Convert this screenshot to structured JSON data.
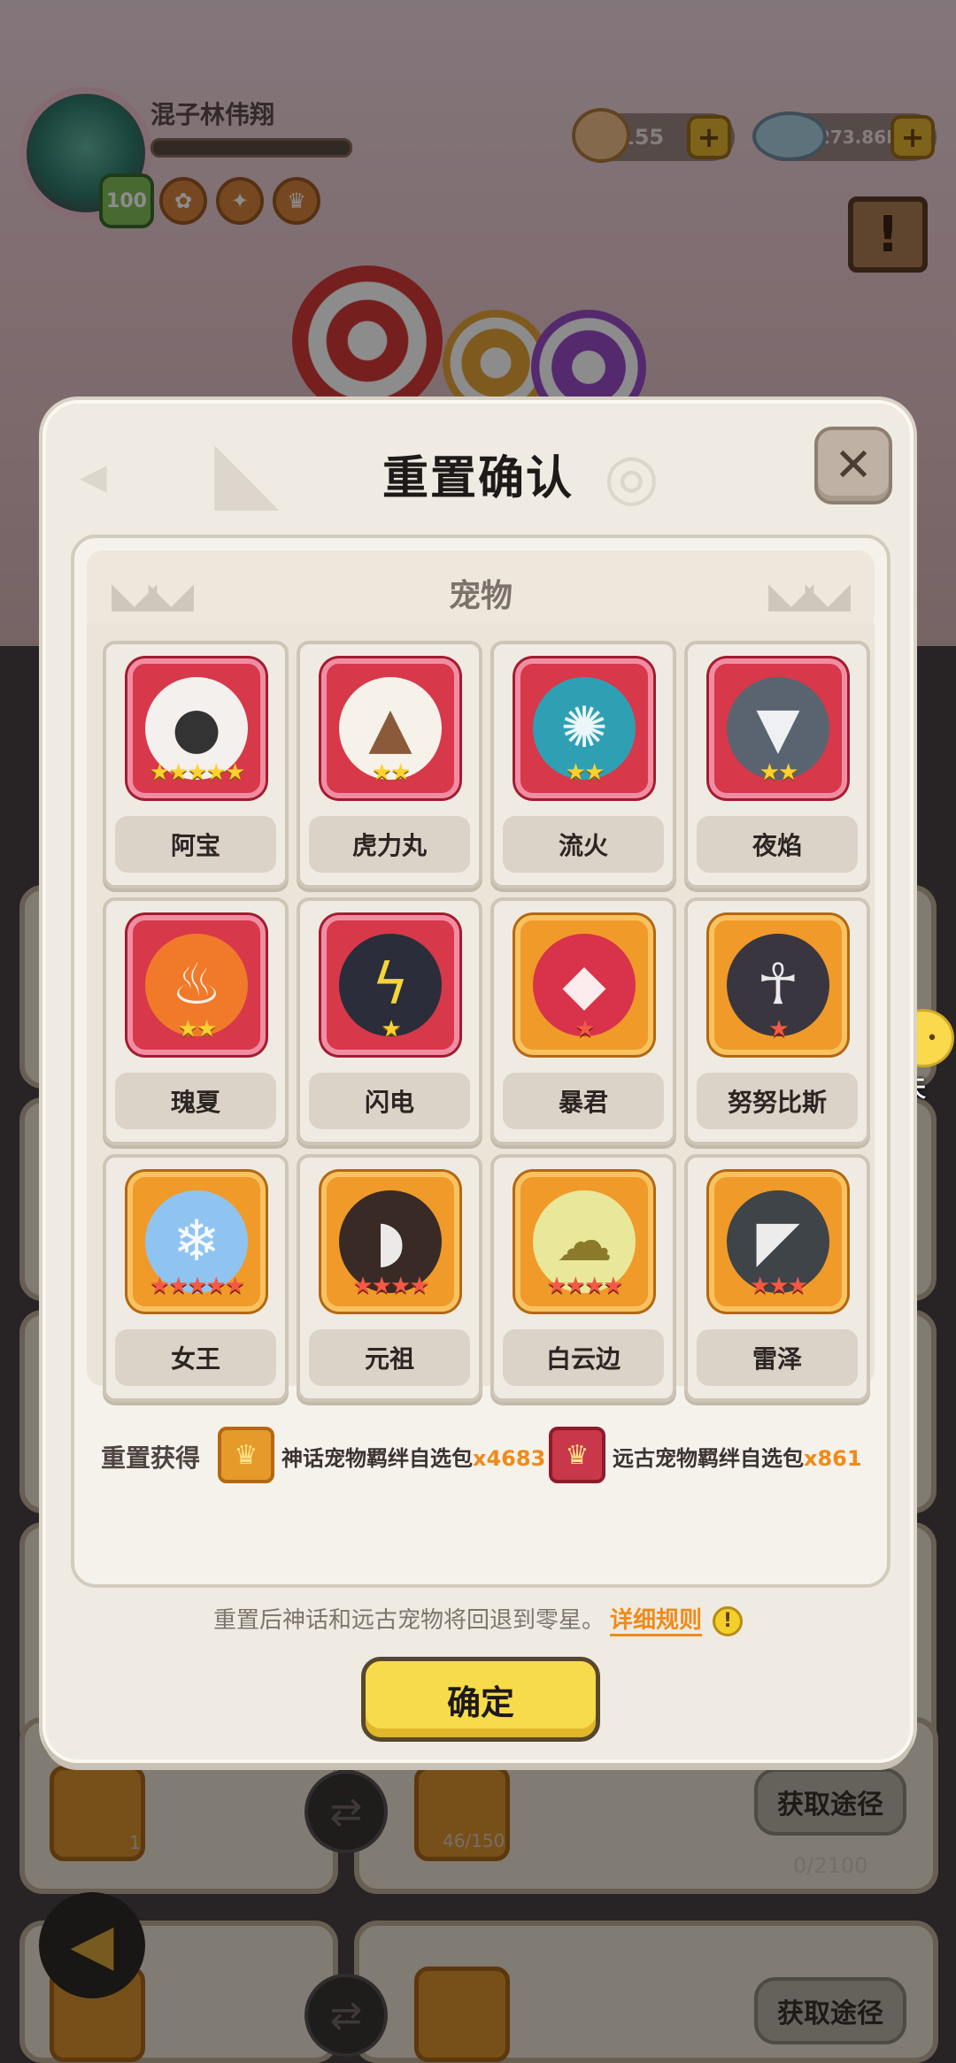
{
  "background": {
    "player_name": "混子林伟翔",
    "level": "100",
    "currency_1": "155",
    "currency_2": "4273.86M",
    "plus_symbol": "+",
    "chat_label": "聊天",
    "get_path_label_1": "获取途径",
    "get_path_label_2": "获取途径",
    "progress_text": "0/2100",
    "card_count": "1",
    "card_progress": "46/150"
  },
  "dialog": {
    "title": "重置确认",
    "close_symbol": "✕",
    "section_title": "宠物",
    "pets": [
      {
        "name": "阿宝",
        "rarity": "red",
        "stars": "★★★★★",
        "star_color": "gold"
      },
      {
        "name": "虎力丸",
        "rarity": "red",
        "stars": "★★",
        "star_color": "gold"
      },
      {
        "name": "流火",
        "rarity": "red",
        "stars": "★★",
        "star_color": "gold"
      },
      {
        "name": "夜焰",
        "rarity": "red",
        "stars": "★★",
        "star_color": "gold"
      },
      {
        "name": "瑰夏",
        "rarity": "red",
        "stars": "★★",
        "star_color": "gold"
      },
      {
        "name": "闪电",
        "rarity": "red",
        "stars": "★",
        "star_color": "gold"
      },
      {
        "name": "暴君",
        "rarity": "gold",
        "stars": "★",
        "star_color": "red"
      },
      {
        "name": "努努比斯",
        "rarity": "gold",
        "stars": "★",
        "star_color": "red"
      },
      {
        "name": "女王",
        "rarity": "gold",
        "stars": "★★★★★",
        "star_color": "red"
      },
      {
        "name": "元祖",
        "rarity": "gold",
        "stars": "★★★★",
        "star_color": "red"
      },
      {
        "name": "白云边",
        "rarity": "gold",
        "stars": "★★★★",
        "star_color": "red"
      },
      {
        "name": "雷泽",
        "rarity": "gold",
        "stars": "★★★",
        "star_color": "red"
      }
    ],
    "reward_label": "重置获得",
    "rewards": [
      {
        "name": "神话宠物羁绊自选包",
        "qty": "x4683"
      },
      {
        "name": "远古宠物羁绊自选包",
        "qty": "x861"
      }
    ],
    "note_text": "重置后神话和远古宠物将回退到零星。",
    "rules_link": "详细规则",
    "info_symbol": "!",
    "confirm_label": "确定"
  }
}
